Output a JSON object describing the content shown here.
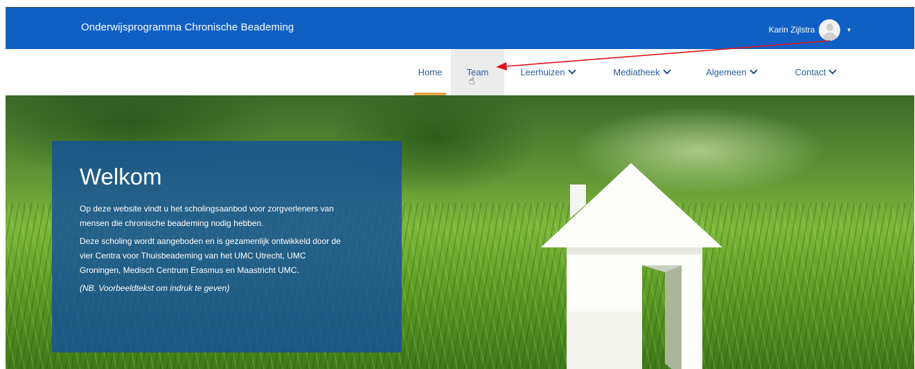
{
  "header": {
    "brand": "Onderwijsprogramma Chronische Beademing",
    "user_name": "Karin Zijlstra",
    "user_caret": "▾",
    "colors": {
      "bar": "#1060c4",
      "active_underline": "#e0a54a"
    }
  },
  "nav": {
    "items": [
      {
        "label": "Home",
        "active": true
      },
      {
        "label": "Team",
        "hovered": true
      },
      {
        "label": "Leerhuizen",
        "dropdown": true
      },
      {
        "label": "Mediatheek",
        "dropdown": true
      },
      {
        "label": "Algemeen",
        "dropdown": true
      },
      {
        "label": "Contact",
        "dropdown": true
      }
    ]
  },
  "hero": {
    "title": "Welkom",
    "paragraphs": [
      "Op deze website vindt u het scholingsaanbod voor zorgverleners van mensen die chronische beademing nodig hebben.",
      "Deze scholing wordt aangeboden en is gezamenlijk ontwikkeld door de vier Centra voor Thuisbeademing van het UMC Utrecht, UMC Groningen, Medisch Centrum Erasmus en Maastricht UMC."
    ],
    "note": "(NB. Voorbeeldtekst om indruk te geven)",
    "image": "white-paper-house-on-grass"
  },
  "annotation": {
    "arrow": "red-arrow-from-avatar-to-team",
    "color": "#e0141b"
  }
}
